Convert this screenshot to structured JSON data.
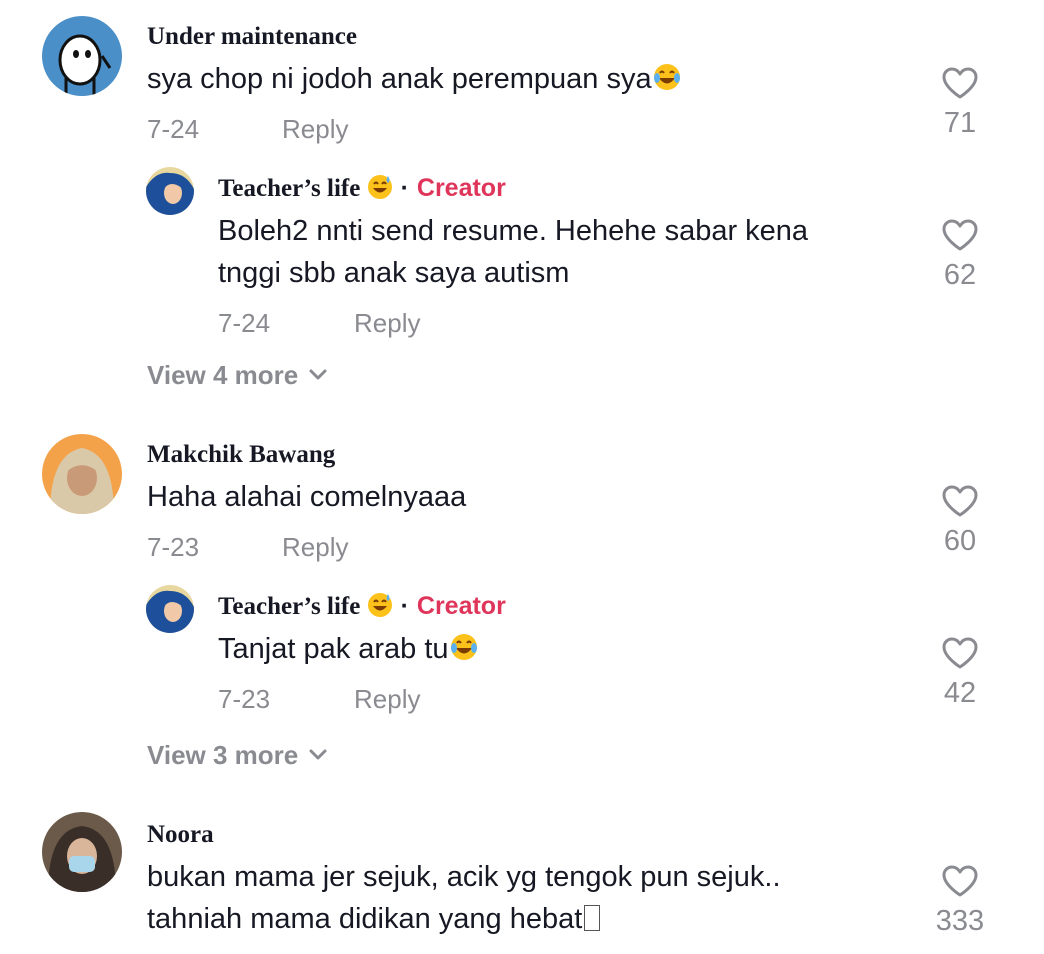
{
  "colors": {
    "accent_creator": "#e0355a",
    "muted": "#8a8b91",
    "text": "#161823"
  },
  "comments": [
    {
      "username": "Under maintenance",
      "text": "sya chop ni jodoh anak perempuan sya",
      "text_emoji": "laughing-tears-emoji",
      "date": "7-24",
      "reply_label": "Reply",
      "likes": "71",
      "reply": {
        "username": "Teacher’s life",
        "badge": "Creator",
        "line1": "Boleh2 nnti send resume. Hehehe sabar kena",
        "line2": "tnggi sbb anak saya autism",
        "date": "7-24",
        "reply_label": "Reply",
        "likes": "62"
      },
      "view_more": "View 4 more"
    },
    {
      "username": "Makchik Bawang",
      "text": "Haha alahai comelnyaaa",
      "date": "7-23",
      "reply_label": "Reply",
      "likes": "60",
      "reply": {
        "username": "Teacher’s life",
        "badge": "Creator",
        "line1": "Tanjat pak arab tu",
        "date": "7-23",
        "reply_label": "Reply",
        "likes": "42"
      },
      "view_more": "View 3 more"
    },
    {
      "username": "Noora",
      "line1": "bukan mama jer sejuk, acik yg tengok pun sejuk..",
      "line2": "tahniah mama didikan yang hebat",
      "likes": "333"
    }
  ]
}
